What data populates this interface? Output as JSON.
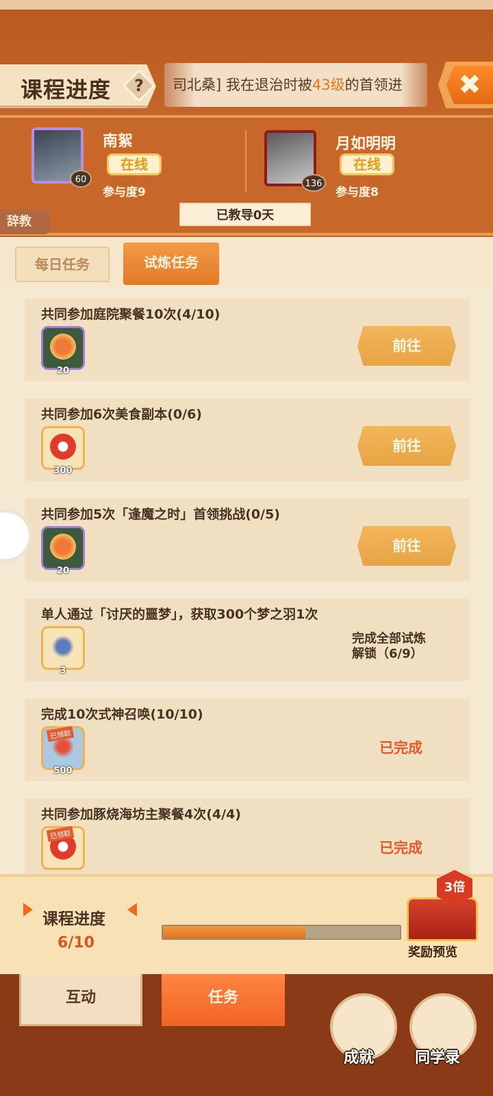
{
  "header": {
    "title": "课程进度",
    "help_icon": "?",
    "marquee_prefix": "司北桑] 我在退治时被",
    "marquee_highlight": "43级",
    "marquee_suffix": "的首领进",
    "close_icon": "✖"
  },
  "players": [
    {
      "name": "南絮",
      "status": "在线",
      "level": "60",
      "participation": "参与度9"
    },
    {
      "name": "月如明明",
      "status": "在线",
      "level": "136",
      "participation": "参与度8"
    }
  ],
  "days_taught": "已教导0天",
  "resign_label": "辞教",
  "tabs": {
    "daily": "每日任务",
    "trial": "试炼任务"
  },
  "tasks": [
    {
      "title": "共同参加庭院聚餐10次(4/10)",
      "reward_count": "20",
      "action": "前往"
    },
    {
      "title": "共同参加6次美食副本(0/6)",
      "reward_count": "300",
      "action": "前往"
    },
    {
      "title": "共同参加5次「逢魔之时」首领挑战(0/5)",
      "reward_count": "20",
      "action": "前往"
    },
    {
      "title": "单人通过「讨厌的噩梦」，获取300个梦之羽1次",
      "reward_count": "3",
      "locked_line1": "完成全部试炼",
      "locked_line2": "解锁（6/9）"
    },
    {
      "title": "完成10次式神召唤(10/10)",
      "reward_count": "500",
      "claimed": "已领取",
      "status": "已完成"
    },
    {
      "title": "共同参加豚烧海坊主聚餐4次(4/4)",
      "claimed": "已领取",
      "status": "已完成"
    }
  ],
  "progress": {
    "label": "课程进度",
    "count": "6/10",
    "fraction": 0.6
  },
  "reward": {
    "multiplier": "3倍",
    "preview_label": "奖励预览"
  },
  "bottom": {
    "interact": "互动",
    "tasks": "任务",
    "achievements": "成就",
    "classmates": "同学录"
  },
  "colors": {
    "accent": "#e47a15",
    "header": "#c8672a",
    "done": "#e45a2a"
  }
}
